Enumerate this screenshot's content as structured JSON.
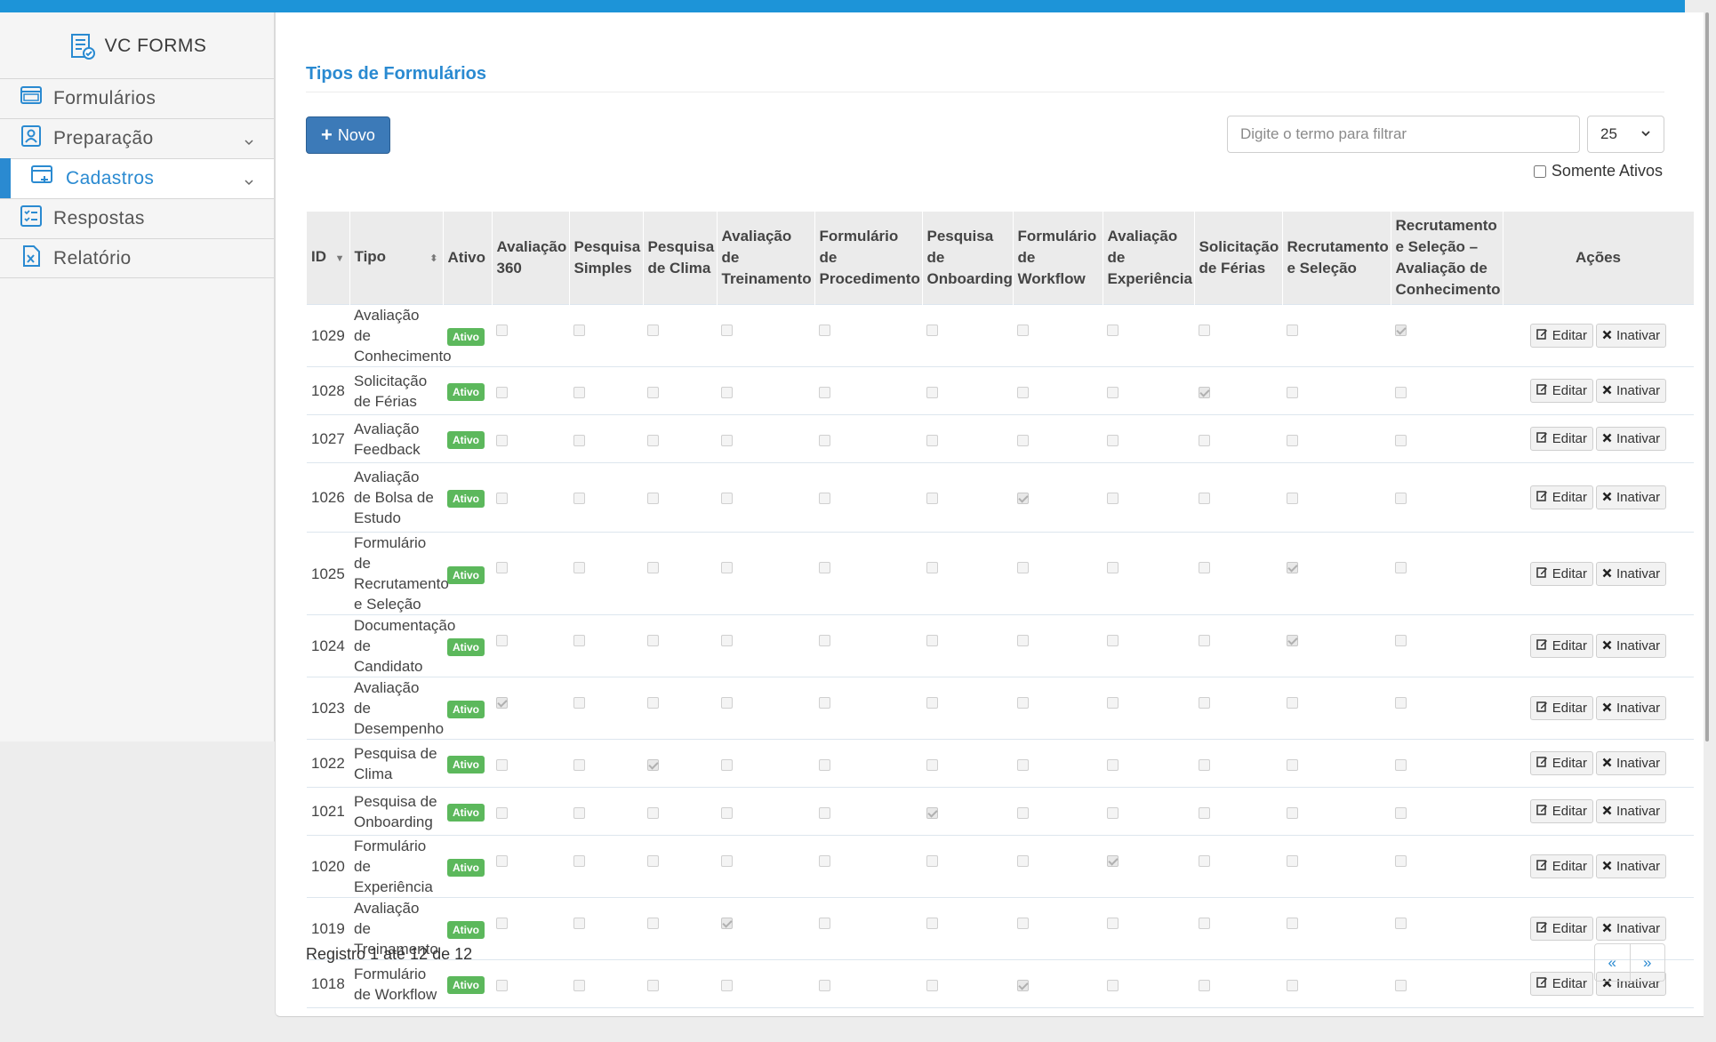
{
  "app": {
    "title": "VC FORMS"
  },
  "sidebar": {
    "items": [
      {
        "label": "Formulários",
        "icon": "forms-icon",
        "has_chevron": false,
        "active": false
      },
      {
        "label": "Preparação",
        "icon": "user-card-icon",
        "has_chevron": true,
        "active": false
      },
      {
        "label": "Cadastros",
        "icon": "window-add-icon",
        "has_chevron": true,
        "active": true
      },
      {
        "label": "Respostas",
        "icon": "checklist-icon",
        "has_chevron": false,
        "active": false
      },
      {
        "label": "Relatório",
        "icon": "excel-file-icon",
        "has_chevron": false,
        "active": false
      }
    ]
  },
  "main": {
    "title": "Tipos de Formulários",
    "new_button": "Novo",
    "filter_placeholder": "Digite o termo para filtrar",
    "page_size": "25",
    "active_only_label": "Somente Ativos",
    "footer": "Registro 1 até 12 de 12",
    "pager": {
      "prev": "«",
      "next": "»"
    }
  },
  "table": {
    "columns": {
      "id": "ID",
      "tipo": "Tipo",
      "ativo": "Ativo",
      "c1": "Avaliação 360",
      "c2": "Pesquisa Simples",
      "c3": "Pesquisa de Clima",
      "c4": "Avaliação de Treinamento",
      "c5": "Formulário de Procedimento",
      "c6": "Pesquisa de Onboarding",
      "c7": "Formulário de Workflow",
      "c8": "Avaliação de Experiência",
      "c9": "Solicitação de Férias",
      "c10": "Recrutamento e Seleção",
      "c11": "Recrutamento e Seleção – Avaliação de Conhecimento",
      "acoes": "Ações"
    },
    "status_label": "Ativo",
    "edit_label": "Editar",
    "deactivate_label": "Inativar",
    "rows": [
      {
        "id": "1029",
        "tipo": "Avaliação de Conhecimento",
        "checked": 11
      },
      {
        "id": "1028",
        "tipo": "Solicitação de Férias",
        "checked": 9
      },
      {
        "id": "1027",
        "tipo": "Avaliação Feedback",
        "checked": 0
      },
      {
        "id": "1026",
        "tipo": "Avaliação de Bolsa de Estudo",
        "checked": 7
      },
      {
        "id": "1025",
        "tipo": "Formulário de Recrutamento e Seleção",
        "checked": 10
      },
      {
        "id": "1024",
        "tipo": "Documentação de Candidato",
        "checked": 10
      },
      {
        "id": "1023",
        "tipo": "Avaliação de Desempenho",
        "checked": 1
      },
      {
        "id": "1022",
        "tipo": "Pesquisa de Clima",
        "checked": 3
      },
      {
        "id": "1021",
        "tipo": "Pesquisa de Onboarding",
        "checked": 6
      },
      {
        "id": "1020",
        "tipo": "Formulário de Experiência",
        "checked": 8
      },
      {
        "id": "1019",
        "tipo": "Avaliação de Treinamento",
        "checked": 4
      },
      {
        "id": "1018",
        "tipo": "Formulário de Workflow",
        "checked": 7
      }
    ]
  },
  "colors": {
    "accent": "#2a8ad1",
    "topbar": "#1d94d8",
    "badge": "#5cb85c",
    "button": "#3c7ab8"
  }
}
